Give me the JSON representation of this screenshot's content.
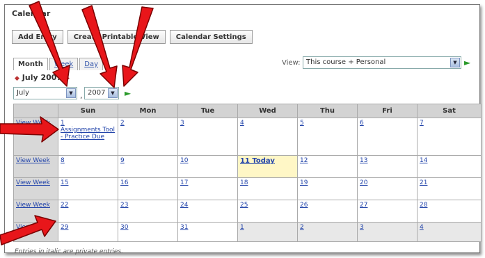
{
  "window_title": "Calendar",
  "toolbar": {
    "add_entry": "Add Entry",
    "create_printable": "Create Printable View",
    "settings": "Calendar Settings"
  },
  "tabs": [
    "Month",
    "Week",
    "Day"
  ],
  "view": {
    "label": "View:",
    "selected": "This course + Personal"
  },
  "month_header": "July 2007",
  "month_select": "July",
  "year_select": "2007",
  "day_headers": [
    "Sun",
    "Mon",
    "Tue",
    "Wed",
    "Thu",
    "Fri",
    "Sat"
  ],
  "view_week_label": "View Week",
  "weeks": [
    {
      "days": [
        "1",
        "2",
        "3",
        "4",
        "5",
        "6",
        "7"
      ]
    },
    {
      "days": [
        "8",
        "9",
        "10",
        "11 Today",
        "12",
        "13",
        "14"
      ]
    },
    {
      "days": [
        "15",
        "16",
        "17",
        "18",
        "19",
        "20",
        "21"
      ]
    },
    {
      "days": [
        "22",
        "23",
        "24",
        "25",
        "26",
        "27",
        "28"
      ]
    },
    {
      "days": [
        "29",
        "30",
        "31",
        "1",
        "2",
        "3",
        "4"
      ]
    }
  ],
  "event": "Assignments Tool - Practice Due",
  "footer": "Entries in italic are private entries.",
  "colors": {
    "arrow": "#e8161a",
    "link": "#2244aa",
    "today": "#fff7c6",
    "header_bg": "#d3d3d3"
  }
}
